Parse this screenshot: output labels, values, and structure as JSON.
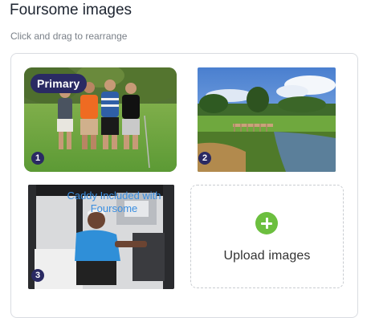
{
  "header": {
    "title": "Foursome images",
    "subtitle": "Click and drag to rearrange"
  },
  "images": [
    {
      "position": "1",
      "badge": "Primary",
      "depicts": "four golfers on course",
      "icon": "photo"
    },
    {
      "position": "2",
      "depicts": "golf course with bridge and pond",
      "icon": "photo"
    },
    {
      "position": "3",
      "caption": "Caddy Included with Foursome",
      "depicts": "caddy in golf cart",
      "icon": "photo"
    }
  ],
  "upload": {
    "label": "Upload images",
    "icon": "plus-circle-icon",
    "icon_color": "#6cbf3f"
  },
  "colors": {
    "badge_bg": "#2a2a63",
    "caption": "#3a8ee0"
  }
}
